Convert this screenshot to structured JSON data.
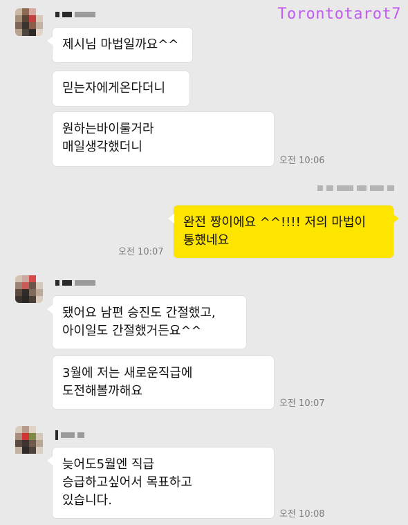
{
  "watermark": "Torontotarot7",
  "messages": [
    {
      "text": "제시님 마법일까요^^"
    },
    {
      "text": "믿는자에게온다더니"
    },
    {
      "text": "원하는바이룰거라\n매일생각했더니",
      "time": "오전 10:06"
    },
    {
      "text": "완전 짱이에요 ^^!!!! 저의 마법이\n통했네요",
      "time": "오전 10:07"
    },
    {
      "text": "됐어요 남편 승진도 간절했고,\n아이일도 간절했거든요^^"
    },
    {
      "text": "3월에 저는 새로운직급에\n도전해볼까해요",
      "time": "오전 10:07"
    },
    {
      "text": "늦어도5월엔 직급\n승급하고싶어서 목표하고\n있습니다.",
      "time": "오전 10:08"
    }
  ],
  "colors": {
    "background": "#e9e9e9",
    "incoming_bubble": "#ffffff",
    "outgoing_bubble": "#fee500",
    "watermark": "#c05cf0",
    "timestamp": "#7a7a7a"
  },
  "icons": [
    "avatar-image",
    "avatar-image",
    "avatar-image"
  ]
}
